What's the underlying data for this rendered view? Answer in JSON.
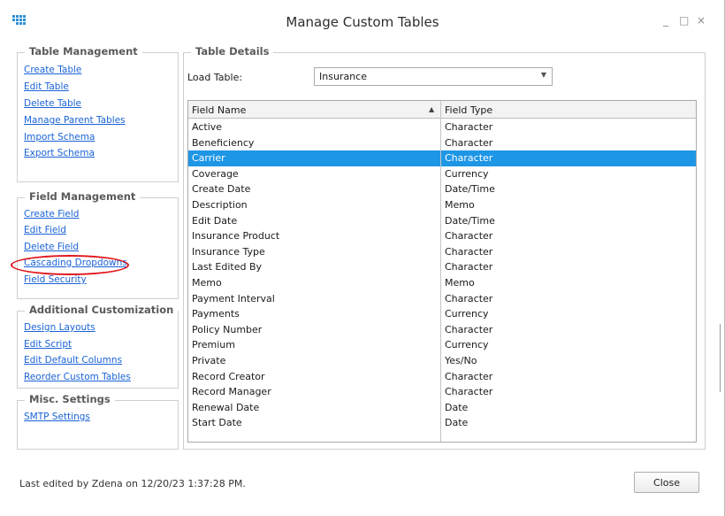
{
  "window": {
    "title": "Manage Custom Tables",
    "icon": "app-grid-icon",
    "controls": {
      "minimize": "_",
      "maximize": "□",
      "close": "×"
    }
  },
  "table_management": {
    "title": "Table Management",
    "links": [
      "Create Table",
      "Edit Table",
      "Delete Table",
      "Manage Parent Tables",
      "Import Schema",
      "Export Schema"
    ]
  },
  "field_management": {
    "title": "Field Management",
    "links": [
      "Create Field",
      "Edit Field",
      "Delete Field",
      "Cascading Dropdowns",
      "Field Security"
    ],
    "highlighted": "Cascading Dropdowns",
    "highlight_color": "#e0161b"
  },
  "additional_customization": {
    "title": "Additional Customization",
    "links": [
      "Design Layouts",
      "Edit Script",
      "Edit Default Columns",
      "Reorder Custom Tables"
    ]
  },
  "misc_settings": {
    "title": "Misc. Settings",
    "links": [
      "SMTP Settings"
    ]
  },
  "table_details": {
    "title": "Table Details",
    "load_table_label": "Load Table:",
    "load_table_value": "Insurance",
    "columns": [
      "Field Name",
      "Field Type"
    ],
    "sort_column": "Field Name",
    "rows": [
      {
        "name": "Active",
        "type": "Character"
      },
      {
        "name": "Beneficiency",
        "type": "Character"
      },
      {
        "name": "Carrier",
        "type": "Character"
      },
      {
        "name": "Coverage",
        "type": "Currency"
      },
      {
        "name": "Create Date",
        "type": "Date/Time"
      },
      {
        "name": "Description",
        "type": "Memo"
      },
      {
        "name": "Edit Date",
        "type": "Date/Time"
      },
      {
        "name": "Insurance Product",
        "type": "Character"
      },
      {
        "name": "Insurance Type",
        "type": "Character"
      },
      {
        "name": "Last Edited By",
        "type": "Character"
      },
      {
        "name": "Memo",
        "type": "Memo"
      },
      {
        "name": "Payment Interval",
        "type": "Character"
      },
      {
        "name": "Payments",
        "type": "Currency"
      },
      {
        "name": "Policy Number",
        "type": "Character"
      },
      {
        "name": "Premium",
        "type": "Currency"
      },
      {
        "name": "Private",
        "type": "Yes/No"
      },
      {
        "name": "Record Creator",
        "type": "Character"
      },
      {
        "name": "Record Manager",
        "type": "Character"
      },
      {
        "name": "Renewal Date",
        "type": "Date"
      },
      {
        "name": "Start Date",
        "type": "Date"
      }
    ],
    "selected_row": "Carrier",
    "selection_color": "#1e96e6"
  },
  "footer": {
    "last_edited": "Last edited by Zdena on 12/20/23 1:37:28 PM.",
    "close_label": "Close"
  },
  "colors": {
    "link": "#1a63d6",
    "accent": "#1e96e6"
  }
}
